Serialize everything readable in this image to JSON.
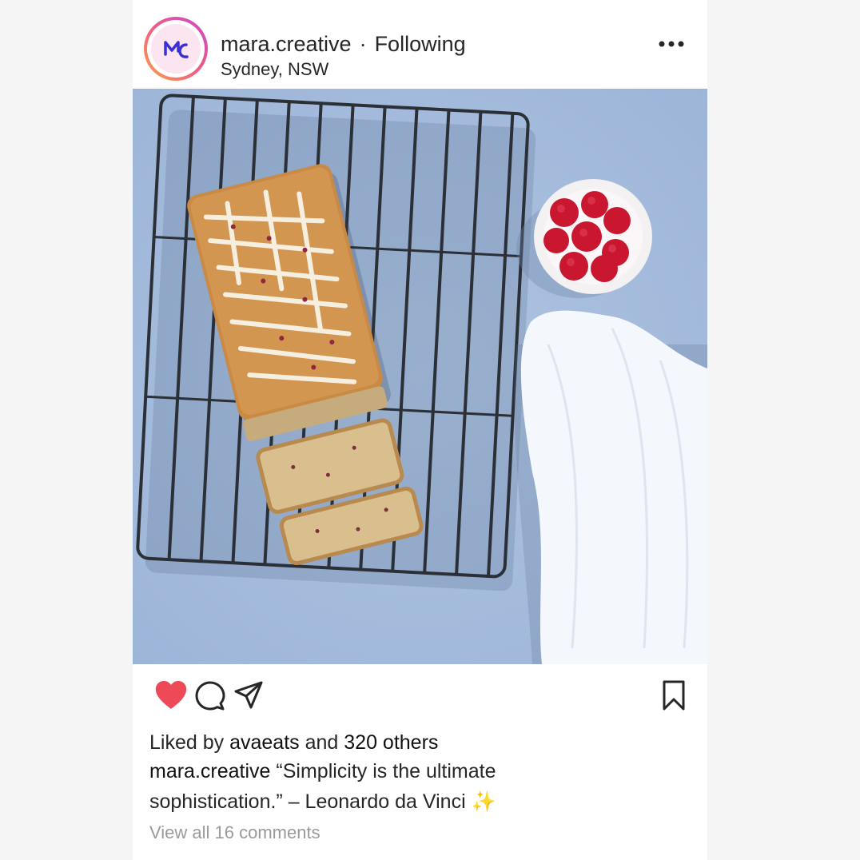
{
  "post": {
    "author": {
      "username": "mara.creative",
      "separator": "·",
      "follow_status": "Following",
      "location": "Sydney, NSW",
      "avatar_initials": "MC"
    },
    "photo": {
      "subject": "loaf-cake-on-cooling-rack-with-raspberries"
    },
    "actions": {
      "liked": true,
      "like_icon": "heart-icon",
      "comment_icon": "comment-icon",
      "share_icon": "send-icon",
      "save_icon": "bookmark-icon",
      "more_icon": "more-options-icon"
    },
    "likes": {
      "prefix": "Liked by",
      "first_liker": "avaeats",
      "connector": "and",
      "others": "320 others"
    },
    "caption": {
      "author": "mara.creative",
      "text": "“Simplicity is the ultimate sophistication.” – Leonardo da Vinci",
      "emoji": "✨"
    },
    "comments": {
      "link_text": "View all 16 comments"
    }
  },
  "colors": {
    "heart": "#ed4956",
    "photo_background": "#a6bedf",
    "avatar_ring_start": "#f9a44b",
    "avatar_ring_end": "#c44cc9",
    "muted_text": "#9a9a9a"
  }
}
